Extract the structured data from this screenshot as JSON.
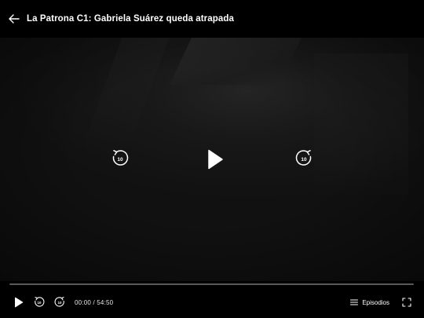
{
  "header": {
    "title": "La Patrona C1: Gabriela Suárez queda atrapada"
  },
  "center_controls": {
    "rewind_seconds": "10",
    "forward_seconds": "10"
  },
  "progress": {
    "fraction": 0
  },
  "bottom_bar": {
    "time_display": "00:00 / 54:50",
    "episodes_label": "Episodios"
  },
  "icons": {
    "back": "arrow-left-icon",
    "play": "play-icon",
    "rewind": "rewind-10-icon",
    "forward": "forward-10-icon",
    "episodes": "list-icon",
    "fullscreen": "fullscreen-icon"
  },
  "colors": {
    "background": "#000000",
    "foreground": "#ffffff",
    "progress_track": "#5a5a5a"
  }
}
